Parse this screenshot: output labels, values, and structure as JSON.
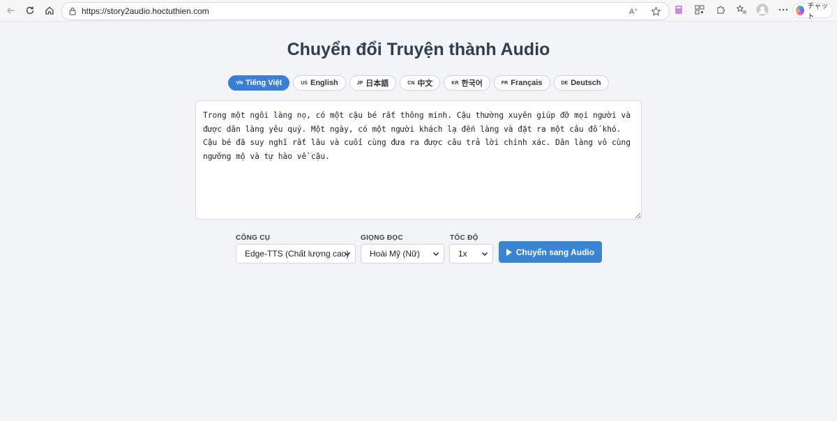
{
  "browser": {
    "url": "https://story2audio.hoctuthien.com",
    "copilot_label": "チャット"
  },
  "page": {
    "title": "Chuyển đổi Truyện thành Audio",
    "languages": [
      {
        "code": "VN",
        "label": "Tiếng Việt",
        "active": true
      },
      {
        "code": "US",
        "label": "English",
        "active": false
      },
      {
        "code": "JP",
        "label": "日本語",
        "active": false
      },
      {
        "code": "CN",
        "label": "中文",
        "active": false
      },
      {
        "code": "KR",
        "label": "한국어",
        "active": false
      },
      {
        "code": "FR",
        "label": "Français",
        "active": false
      },
      {
        "code": "DE",
        "label": "Deutsch",
        "active": false
      }
    ],
    "story_text": "Trong một ngôi làng nọ, có một cậu bé rất thông minh. Cậu thường xuyên giúp đỡ mọi người và được dân làng yêu quý. Một ngày, có một người khách lạ đến làng và đặt ra một câu đố khó. Cậu bé đã suy nghĩ rất lâu và cuối cùng đưa ra được câu trả lời chính xác. Dân làng vô cùng ngưỡng mộ và tự hào về cậu.",
    "controls": {
      "tool_label": "CÔNG CỤ",
      "tool_value": "Edge-TTS (Chất lượng cao)",
      "voice_label": "GIỌNG ĐỌC",
      "voice_value": "Hoài Mỹ (Nữ)",
      "speed_label": "TỐC ĐỘ",
      "speed_value": "1x",
      "convert_label": "Chuyển sang Audio"
    }
  },
  "colors": {
    "accent": "#3a85d3",
    "title": "#2c3e50",
    "background": "#f3f4f8"
  }
}
